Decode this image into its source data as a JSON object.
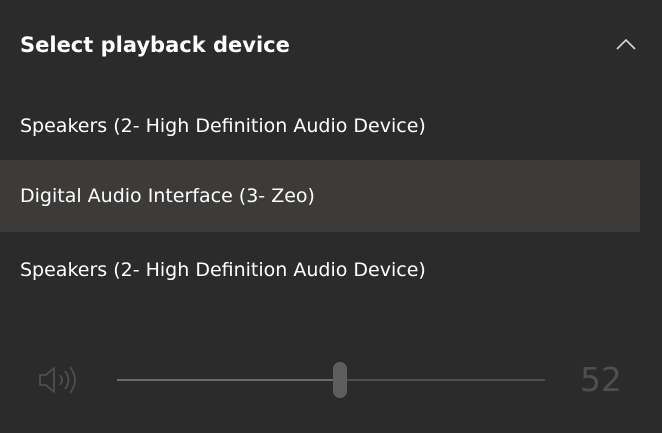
{
  "header": {
    "title": "Select playback device",
    "chevron_icon": "chevron-up-icon"
  },
  "devices": [
    {
      "label": "Speakers (2- High Definition Audio Device)",
      "selected": false
    },
    {
      "label": "Digital Audio Interface (3- Zeo)",
      "selected": true
    },
    {
      "label": "Speakers (2- High Definition Audio Device)",
      "selected": false
    }
  ],
  "volume": {
    "icon": "speaker-icon",
    "value": "52",
    "level": 0.52
  },
  "colors": {
    "background": "#2b2b2b",
    "selected_item": "#3c3b39",
    "text": "#ffffff",
    "disabled": "#4e4e4e"
  }
}
